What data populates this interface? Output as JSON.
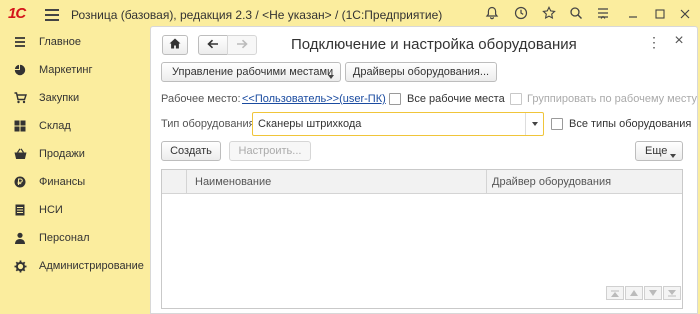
{
  "app": {
    "logo": "1С",
    "title": "Розница (базовая), редакция 2.3 / <Не указан> / (1С:Предприятие)"
  },
  "titlebar_icons": [
    "bell-icon",
    "history-icon",
    "star-icon",
    "search-icon",
    "settings-icon",
    "minimize-icon",
    "maximize-icon",
    "close-icon"
  ],
  "sidebar": {
    "items": [
      {
        "label": "Главное",
        "icon": "menu-icon"
      },
      {
        "label": "Маркетинг",
        "icon": "pie-icon"
      },
      {
        "label": "Закупки",
        "icon": "cart-icon"
      },
      {
        "label": "Склад",
        "icon": "warehouse-icon"
      },
      {
        "label": "Продажи",
        "icon": "basket-icon"
      },
      {
        "label": "Финансы",
        "icon": "coin-icon"
      },
      {
        "label": "НСИ",
        "icon": "catalog-icon"
      },
      {
        "label": "Персонал",
        "icon": "person-icon"
      },
      {
        "label": "Администрирование",
        "icon": "gear-icon"
      }
    ]
  },
  "form": {
    "title": "Подключение и настройка оборудования",
    "more_icon": "⋮",
    "close_icon": "×"
  },
  "toolbar": {
    "workplaces_button": "Управление рабочими местами",
    "drivers_button": "Драйверы оборудования..."
  },
  "workplace": {
    "label": "Рабочее место:",
    "value": "<<Пользователь>>(user-ПК)",
    "all_workplaces_label": "Все рабочие места",
    "all_workplaces_checked": false,
    "group_label": "Группировать по рабочему месту",
    "group_checked": false,
    "group_disabled": true
  },
  "equipment_type": {
    "label": "Тип оборудования:",
    "value": "Сканеры штрихкода",
    "all_types_label": "Все типы оборудования",
    "all_types_checked": false
  },
  "actions": {
    "create": "Создать",
    "configure": "Настроить...",
    "more": "Еще"
  },
  "table": {
    "columns": [
      "Наименование",
      "Драйвер оборудования"
    ],
    "rows": []
  },
  "colors": {
    "background": "#fbed9e",
    "link": "#1a4ba0",
    "logo": "#d4151b",
    "select_border": "#f0c53a"
  }
}
